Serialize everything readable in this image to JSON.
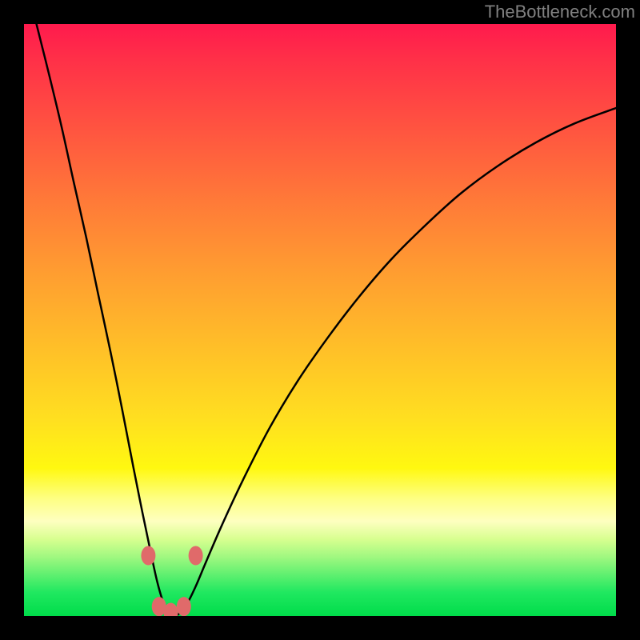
{
  "watermark": "TheBottleneck.com",
  "chart_data": {
    "type": "line",
    "title": "",
    "xlabel": "",
    "ylabel": "",
    "x_range": [
      0,
      1
    ],
    "y_range": [
      0,
      1
    ],
    "series": [
      {
        "name": "curve",
        "x": [
          0.021,
          0.043,
          0.064,
          0.084,
          0.105,
          0.125,
          0.146,
          0.166,
          0.185,
          0.2,
          0.214,
          0.225,
          0.235,
          0.244,
          0.252,
          0.262,
          0.275,
          0.29,
          0.309,
          0.335,
          0.37,
          0.415,
          0.463,
          0.513,
          0.565,
          0.62,
          0.678,
          0.738,
          0.8,
          0.865,
          0.93,
          1.0
        ],
        "y": [
          1.0,
          0.912,
          0.824,
          0.733,
          0.64,
          0.545,
          0.447,
          0.348,
          0.25,
          0.175,
          0.108,
          0.058,
          0.024,
          0.008,
          0.001,
          0.004,
          0.02,
          0.05,
          0.095,
          0.155,
          0.23,
          0.318,
          0.398,
          0.47,
          0.538,
          0.602,
          0.66,
          0.714,
          0.76,
          0.8,
          0.832,
          0.858
        ]
      }
    ],
    "markers": [
      {
        "x": 0.21,
        "y": 0.102
      },
      {
        "x": 0.228,
        "y": 0.016
      },
      {
        "x": 0.248,
        "y": 0.006
      },
      {
        "x": 0.27,
        "y": 0.016
      },
      {
        "x": 0.29,
        "y": 0.102
      }
    ],
    "background": "rainbow-gradient",
    "frame_color": "#000000"
  }
}
